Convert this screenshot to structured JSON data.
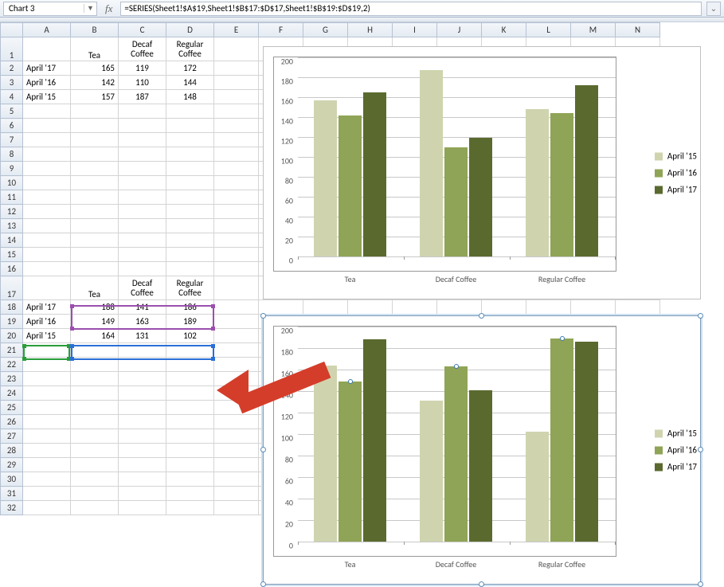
{
  "namebox": "Chart 3",
  "formula": "=SERIES(Sheet1!$A$19,Sheet1!$B$17:$D$17,Sheet1!$B$19:$D$19,2)",
  "columns": [
    "A",
    "B",
    "C",
    "D",
    "E",
    "F",
    "G",
    "H",
    "I",
    "J",
    "K",
    "L",
    "M",
    "N"
  ],
  "rows": [
    "1",
    "2",
    "3",
    "4",
    "5",
    "6",
    "7",
    "8",
    "9",
    "10",
    "11",
    "12",
    "13",
    "14",
    "15",
    "16",
    "17",
    "18",
    "19",
    "20",
    "21",
    "22",
    "23",
    "24",
    "25",
    "26",
    "27",
    "28",
    "29",
    "30",
    "31",
    "32"
  ],
  "table1": {
    "headers": [
      "Tea",
      "Decaf Coffee",
      "Regular Coffee"
    ],
    "row1_label": "April '17",
    "row1": [
      165,
      119,
      172
    ],
    "row2_label": "April '16",
    "row2": [
      142,
      110,
      144
    ],
    "row3_label": "April '15",
    "row3": [
      157,
      187,
      148
    ]
  },
  "table2": {
    "headers": [
      "Tea",
      "Decaf Coffee",
      "Regular Coffee"
    ],
    "row1_label": "April '17",
    "row1": [
      188,
      141,
      186
    ],
    "row2_label": "April '16",
    "row2": [
      149,
      163,
      189
    ],
    "row3_label": "April '15",
    "row3": [
      164,
      131,
      102
    ]
  },
  "legend": {
    "l15": "April '15",
    "l16": "April '16",
    "l17": "April '17"
  },
  "xcats": {
    "c1": "Tea",
    "c2": "Decaf Coffee",
    "c3": "Regular Coffee"
  },
  "yticks": [
    0,
    20,
    40,
    60,
    80,
    100,
    120,
    140,
    160,
    180,
    200
  ],
  "chart_data": [
    {
      "type": "bar",
      "title": "",
      "categories": [
        "Tea",
        "Decaf Coffee",
        "Regular Coffee"
      ],
      "series": [
        {
          "name": "April '15",
          "values": [
            157,
            187,
            148
          ]
        },
        {
          "name": "April '16",
          "values": [
            142,
            110,
            144
          ]
        },
        {
          "name": "April '17",
          "values": [
            165,
            119,
            172
          ]
        }
      ],
      "xlabel": "",
      "ylabel": "",
      "ylim": [
        0,
        200
      ],
      "legend_position": "right"
    },
    {
      "type": "bar",
      "title": "",
      "categories": [
        "Tea",
        "Decaf Coffee",
        "Regular Coffee"
      ],
      "series": [
        {
          "name": "April '15",
          "values": [
            164,
            131,
            102
          ]
        },
        {
          "name": "April '16",
          "values": [
            149,
            163,
            189
          ]
        },
        {
          "name": "April '17",
          "values": [
            188,
            141,
            186
          ]
        }
      ],
      "xlabel": "",
      "ylabel": "",
      "ylim": [
        0,
        200
      ],
      "legend_position": "right",
      "selected_series": "April '16"
    }
  ]
}
